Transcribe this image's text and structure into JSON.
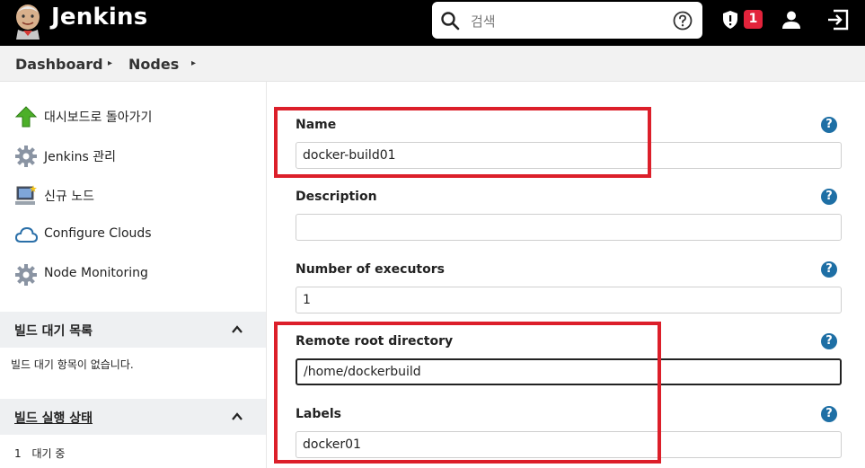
{
  "header": {
    "brand": "Jenkins",
    "search_placeholder": "검색",
    "alert_count": "1",
    "colors": {
      "bar": "#000000",
      "badge": "#e2233b"
    }
  },
  "breadcrumb": {
    "items": [
      "Dashboard",
      "Nodes"
    ],
    "separator": "▸"
  },
  "sidebar": {
    "tasks": [
      {
        "icon": "up-arrow-icon",
        "label": "대시보드로 돌아가기"
      },
      {
        "icon": "gear-icon",
        "label": "Jenkins 관리"
      },
      {
        "icon": "computer-icon",
        "label": "신규 노드"
      },
      {
        "icon": "cloud-icon",
        "label": "Configure Clouds"
      },
      {
        "icon": "gear-icon",
        "label": "Node Monitoring"
      }
    ],
    "build_queue": {
      "title": "빌드 대기 목록",
      "empty_text": "빌드 대기 항목이 없습니다."
    },
    "executors": {
      "title": "빌드 실행 상태",
      "row_number": "1",
      "row_text": "대기 중"
    }
  },
  "form": {
    "help_glyph": "?",
    "fields": [
      {
        "label": "Name",
        "value": "docker-build01"
      },
      {
        "label": "Description",
        "value": ""
      },
      {
        "label": "Number of executors",
        "value": "1"
      },
      {
        "label": "Remote root directory",
        "value": "/home/dockerbuild"
      },
      {
        "label": "Labels",
        "value": "docker01"
      }
    ],
    "highlight_color": "#dc1f2a"
  }
}
